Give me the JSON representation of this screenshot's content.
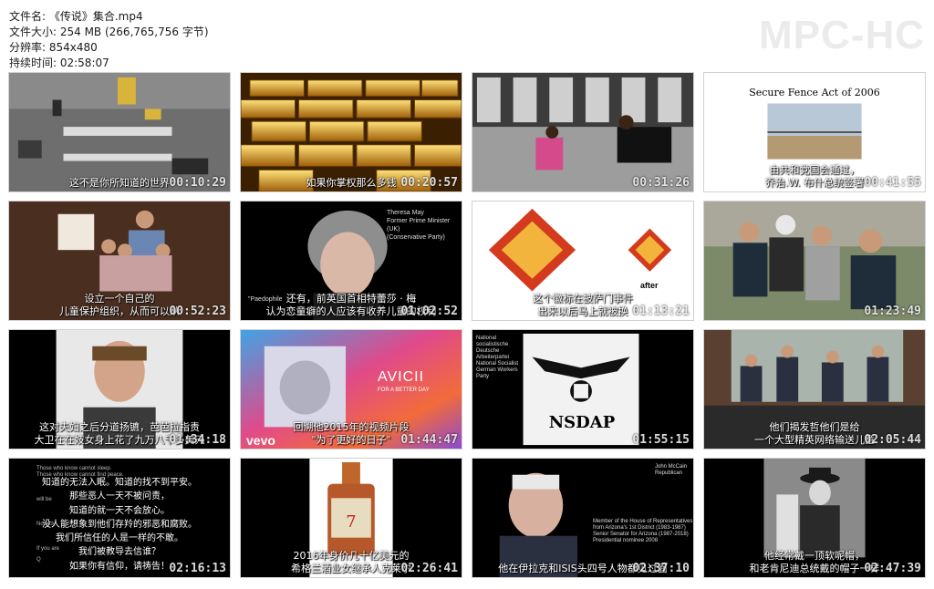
{
  "file_info": {
    "name": "文件名: 《传说》集合.mp4",
    "size": "文件大小: 254 MB (266,765,756 字节)",
    "resolution": "分辨率: 854x480",
    "duration": "持续时间: 02:58:07"
  },
  "logo": "MPC-HC",
  "thumbnails": [
    {
      "timestamp": "00:10:29",
      "caption": [
        "这不是你所知道的世界"
      ]
    },
    {
      "timestamp": "00:20:57",
      "caption": [
        "如果你掌权那么多钱"
      ]
    },
    {
      "timestamp": "00:31:26",
      "caption": []
    },
    {
      "timestamp": "00:41:55",
      "caption": [
        "由共和党国会通过，",
        "乔治.W. 布什总统签署"
      ],
      "overlay": "Secure Fence Act of 2006"
    },
    {
      "timestamp": "00:52:23",
      "caption": [
        "设立一个自己的",
        "儿童保护组织，从而可以从"
      ]
    },
    {
      "timestamp": "01:02:52",
      "caption": [
        "还有，前英国首相特蕾莎 · 梅",
        "认为恋童癖的人应该有收养儿童的权利"
      ],
      "overlay": [
        "Theresa May",
        "Former Prime Minister (UK)",
        "(Conservative Party)"
      ],
      "overlay_left": "\"Paedophile"
    },
    {
      "timestamp": "01:13:21",
      "caption": [
        "这个徽标在披萨门事件",
        "出来以后马上就被换"
      ],
      "overlay": "after"
    },
    {
      "timestamp": "01:23:49",
      "caption": []
    },
    {
      "timestamp": "01:34:18",
      "caption": [
        "这对夫妇之后分道扬镳，芭芭拉指责",
        "大卫在在妓女身上花了九万八千多美元"
      ]
    },
    {
      "timestamp": "01:44:47",
      "caption": [
        "回溯他2015年的视频片段",
        "\"为了更好的日子\""
      ],
      "brand": "AVICII",
      "brand_sub": "FOR A BETTER DAY",
      "vevo": "vevo"
    },
    {
      "timestamp": "01:55:15",
      "caption": [],
      "overlay": [
        "National",
        "socialistische",
        "Deutsche",
        "Arbeiterpartei",
        "",
        "National Socialist",
        "German Workers",
        "Party"
      ],
      "sign": "NSDAP"
    },
    {
      "timestamp": "02:05:44",
      "caption": [
        "他们揭发哲他们是给",
        "一个大型精英网络输送儿童"
      ]
    },
    {
      "timestamp": "02:16:13",
      "caption": [
        "知道的无法入眠。知道的找不到平安。",
        "那些恶人一天不被问责，",
        "知道的就一天不会放心。",
        "没人能想象到他们存羚的邪恶和腐败。",
        "我们所信任的人是一样的不敢。",
        "我们被教导去信谁？",
        "如果你有信仰，请祷告！"
      ],
      "overlay": [
        "Those who know cannot sleep.",
        "Those who know cannot find peace.",
        "will be",
        "Nobody",
        "If you are",
        "Q"
      ]
    },
    {
      "timestamp": "02:26:41",
      "caption": [
        "2016年身价几十亿美元的",
        "希格兰酒业女继承人克莱尔"
      ]
    },
    {
      "timestamp": "02:37:10",
      "caption": [
        "他在伊拉克和ISIS头四号人物都见过面"
      ],
      "overlay": [
        "John McCain",
        "Republican"
      ],
      "overlay_bottom": [
        "Member of the House of Representatives",
        "from Arizona's 1st District (1983-1987)",
        "Senior Senator for Arizona (1987-2018)",
        "Presidential nominee 2008"
      ]
    },
    {
      "timestamp": "02:47:39",
      "caption": [
        "他经常戴一顶软呢帽，",
        "和老肯尼迪总统戴的帽子一样"
      ]
    }
  ]
}
